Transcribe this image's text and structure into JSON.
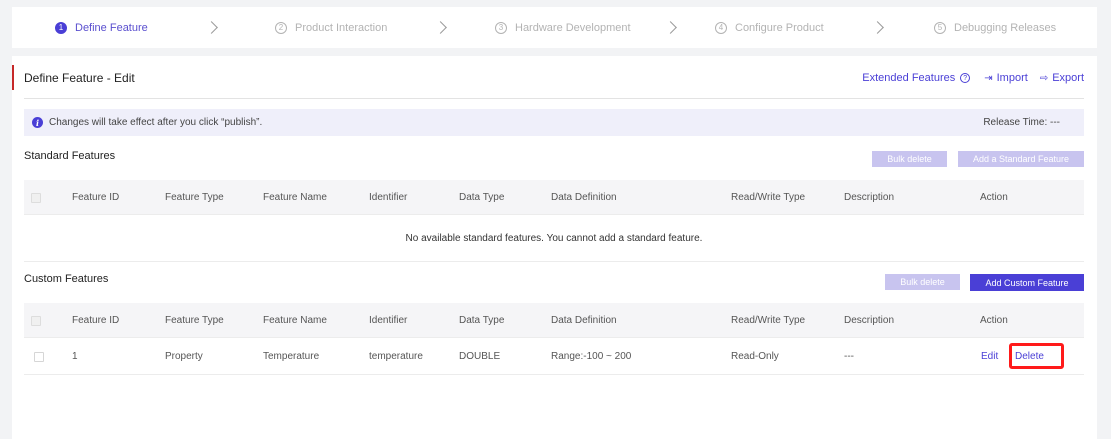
{
  "stepper": {
    "steps": [
      {
        "num": "1",
        "label": "Define Feature"
      },
      {
        "num": "2",
        "label": "Product Interaction"
      },
      {
        "num": "3",
        "label": "Hardware Development"
      },
      {
        "num": "4",
        "label": "Configure Product"
      },
      {
        "num": "5",
        "label": "Debugging Releases"
      }
    ],
    "active_index": 0
  },
  "header": {
    "title": "Define Feature - Edit",
    "extended_features": "Extended Features",
    "import": "Import",
    "export": "Export"
  },
  "notice": {
    "info_glyph": "i",
    "text": "Changes will take effect after you click “publish”.",
    "release_time": "Release Time:  ---"
  },
  "standard": {
    "title": "Standard Features",
    "bulk_delete": "Bulk delete",
    "add_button": "Add a Standard Feature",
    "empty_text": "No available standard features. You cannot add a standard feature."
  },
  "custom": {
    "title": "Custom Features",
    "bulk_delete": "Bulk delete",
    "add_button": "Add Custom Feature",
    "rows": [
      {
        "feature_id": "1",
        "feature_type": "Property",
        "feature_name": "Temperature",
        "identifier": "temperature",
        "data_type": "DOUBLE",
        "data_definition": "Range:-100 ~ 200",
        "read_write_type": "Read-Only",
        "description": "---",
        "edit": "Edit",
        "delete": "Delete"
      }
    ]
  },
  "columns": {
    "feature_id": "Feature ID",
    "feature_type": "Feature Type",
    "feature_name": "Feature Name",
    "identifier": "Identifier",
    "data_type": "Data Type",
    "data_definition": "Data Definition",
    "read_write_type": "Read/Write Type",
    "description": "Description",
    "action": "Action"
  },
  "colors": {
    "accent": "#4a3fd6",
    "highlight": "#ff1a1a",
    "title_bar": "#c62828"
  }
}
